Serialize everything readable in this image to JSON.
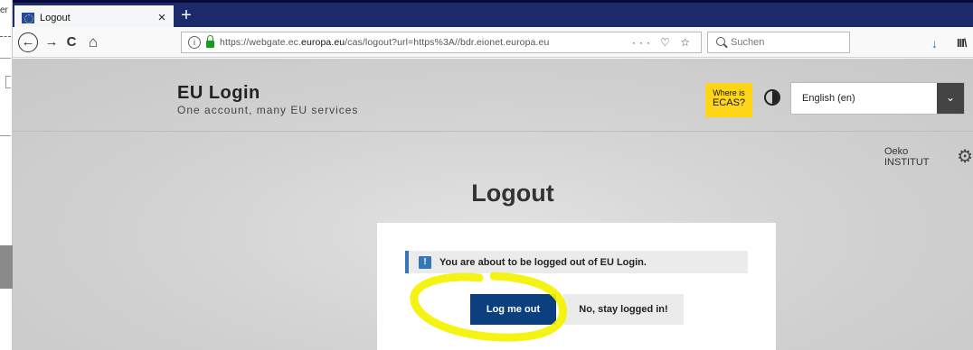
{
  "stray_window": {
    "text_fragment": "er"
  },
  "browser": {
    "tab": {
      "title": "Logout",
      "close_glyph": "×"
    },
    "new_tab_glyph": "+",
    "nav": {
      "back": "←",
      "forward": "→",
      "reload": "C",
      "home": "⌂"
    },
    "url": {
      "info": "i",
      "prefix": "https://webgate.ec.",
      "domain": "europa.eu",
      "suffix": "/cas/logout?url=https%3A//bdr.eionet.europa.eu",
      "actions": "··· ♡ ☆"
    },
    "search": {
      "placeholder": "Suchen"
    },
    "toolbar": {
      "download": "↓",
      "library": "III\\"
    }
  },
  "header": {
    "brand": "EU Login",
    "tagline": "One account, many EU services",
    "ecas": {
      "line1": "Where is",
      "line2": "ECAS?"
    },
    "language": {
      "selected": "English (en)",
      "chevron": "⌄"
    }
  },
  "user": {
    "name": "Oeko INSTITUT",
    "gear": "⚙"
  },
  "main": {
    "title": "Logout",
    "message": "You are about to be logged out of EU Login.",
    "message_icon": "!",
    "primary_button": "Log me out",
    "secondary_button": "No, stay logged in!"
  },
  "colors": {
    "tab_bar": "#1c2a6c",
    "ecas": "#ffd617",
    "primary_button": "#0b3f7d",
    "highlight": "#f4f200",
    "info_accent": "#3477b8"
  }
}
